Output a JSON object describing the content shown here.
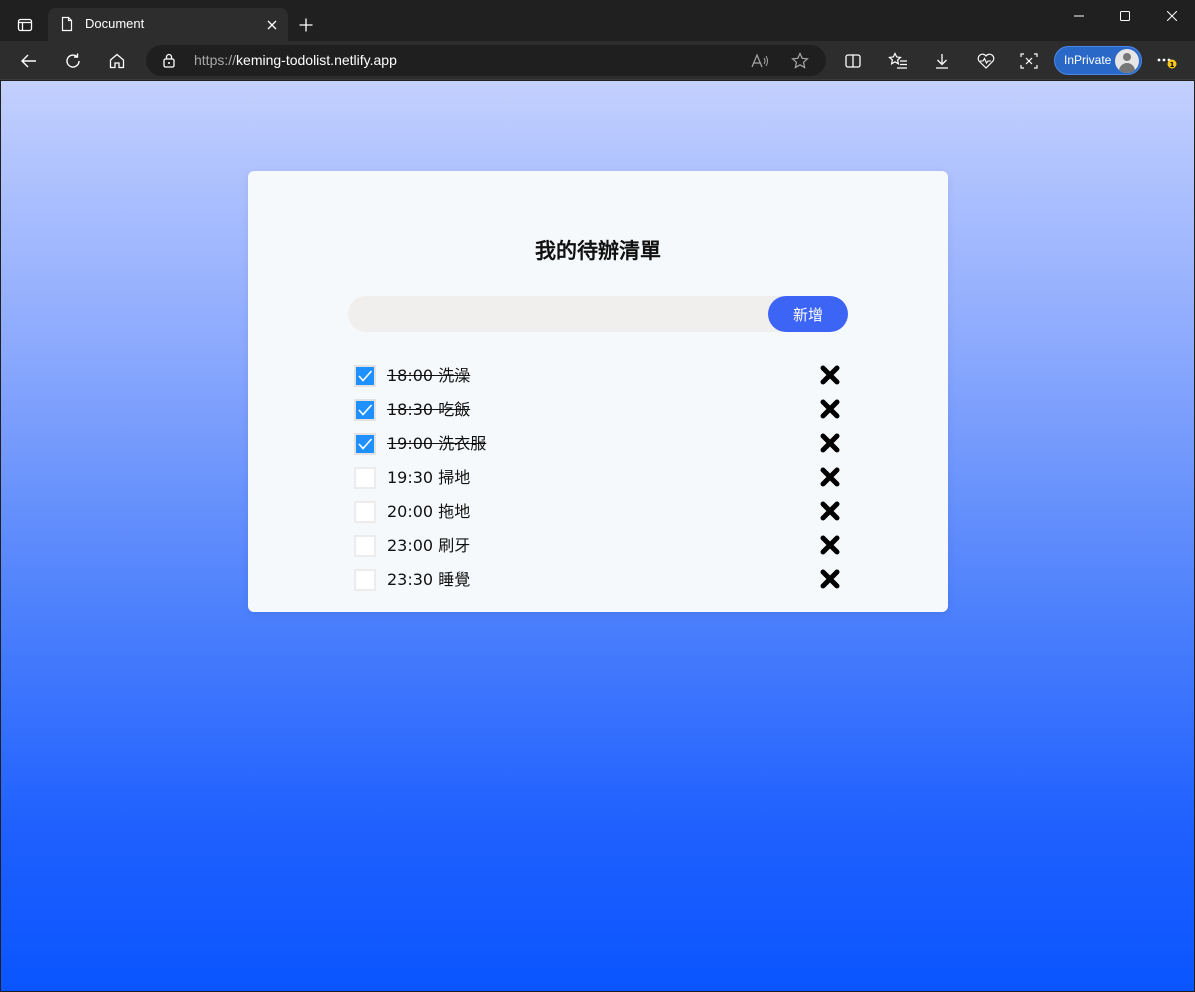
{
  "browser": {
    "tab_title": "Document",
    "url_protocol": "https://",
    "url_host": "keming-todolist.netlify.app",
    "inprivate_label": "InPrivate",
    "notification_badge": "1"
  },
  "app": {
    "title": "我的待辦清單",
    "input": {
      "value": "",
      "placeholder": ""
    },
    "add_button_label": "新增",
    "accent_color": "#3c65f6",
    "check_color": "#1e90ff",
    "todos": [
      {
        "text": "18:00 洗澡",
        "done": true
      },
      {
        "text": "18:30 吃飯",
        "done": true
      },
      {
        "text": "19:00 洗衣服",
        "done": true
      },
      {
        "text": "19:30 掃地",
        "done": false
      },
      {
        "text": "20:00 拖地",
        "done": false
      },
      {
        "text": "23:00 刷牙",
        "done": false
      },
      {
        "text": "23:30 睡覺",
        "done": false
      }
    ]
  }
}
